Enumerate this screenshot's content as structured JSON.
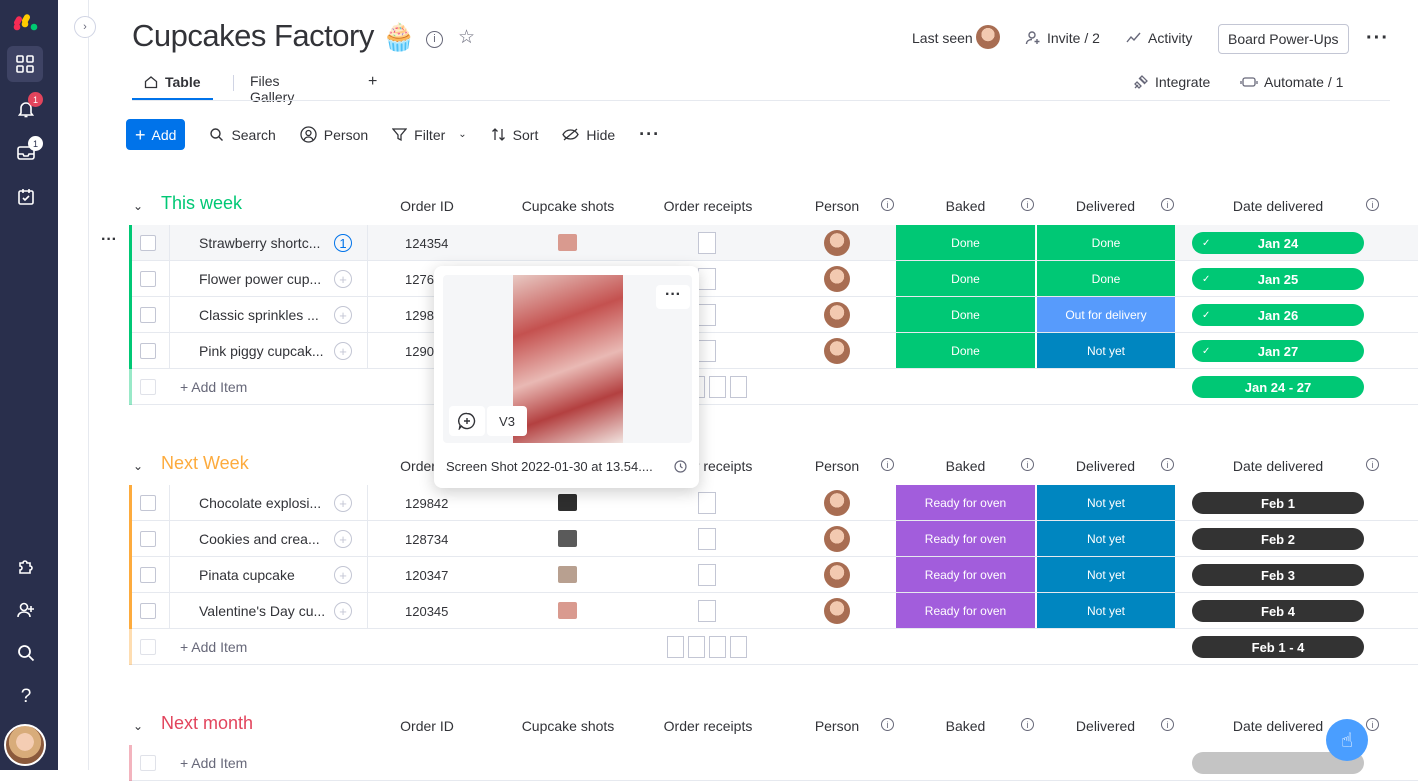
{
  "app": {
    "logo": "monday-logo"
  },
  "rail": {
    "notif_badge": "1",
    "inbox_badge": "1"
  },
  "board": {
    "title": "Cupcakes Factory",
    "emoji": "🧁"
  },
  "header": {
    "last_seen": "Last seen",
    "invite": "Invite / 2",
    "activity": "Activity",
    "powerups": "Board Power-Ups",
    "integrate": "Integrate",
    "automate": "Automate / 1"
  },
  "tabs": [
    {
      "label": "Table"
    },
    {
      "label": "Files Gallery"
    }
  ],
  "toolbar": {
    "add": "Add",
    "search": "Search",
    "person": "Person",
    "filter": "Filter",
    "sort": "Sort",
    "hide": "Hide"
  },
  "columns": {
    "order_id": "Order ID",
    "shots": "Cupcake shots",
    "receipts": "Order receipts",
    "person": "Person",
    "baked": "Baked",
    "delivered": "Delivered",
    "date": "Date delivered"
  },
  "colors": {
    "green": "#00c875",
    "orange": "#fdab3d",
    "red": "#e2445c",
    "purple": "#a25ddc",
    "blue": "#0086c0",
    "lightblue": "#579bfc",
    "dark": "#333333"
  },
  "groups": [
    {
      "title": "This week",
      "color": "#00c875",
      "items": [
        {
          "name": "Strawberry shortc...",
          "order_id": "124354",
          "baked": "Done",
          "delivered": "Done",
          "date": "Jan 24"
        },
        {
          "name": "Flower power cup...",
          "order_id": "1276",
          "baked": "Done",
          "delivered": "Done",
          "date": "Jan 25"
        },
        {
          "name": "Classic sprinkles ...",
          "order_id": "1298",
          "baked": "Done",
          "delivered": "Out for delivery",
          "date": "Jan 26"
        },
        {
          "name": "Pink piggy cupcak...",
          "order_id": "1290",
          "baked": "Done",
          "delivered": "Not yet",
          "date": "Jan 27"
        }
      ],
      "add_item": "+ Add Item",
      "summary_date": "Jan 24 - 27"
    },
    {
      "title": "Next Week",
      "color": "#fdab3d",
      "items": [
        {
          "name": "Chocolate explosi...",
          "order_id": "129842",
          "baked": "Ready for oven",
          "delivered": "Not yet",
          "date": "Feb 1"
        },
        {
          "name": "Cookies and crea...",
          "order_id": "128734",
          "baked": "Ready for oven",
          "delivered": "Not yet",
          "date": "Feb 2"
        },
        {
          "name": "Pinata cupcake",
          "order_id": "120347",
          "baked": "Ready for oven",
          "delivered": "Not yet",
          "date": "Feb 3"
        },
        {
          "name": "Valentine's Day cu...",
          "order_id": "120345",
          "baked": "Ready for oven",
          "delivered": "Not yet",
          "date": "Feb 4"
        }
      ],
      "add_item": "+ Add Item",
      "summary_date": "Feb 1 - 4"
    },
    {
      "title": "Next month",
      "color": "#e2445c",
      "items": [],
      "add_item": "+ Add Item"
    }
  ],
  "popup": {
    "version": "V3",
    "filename": "Screen Shot 2022-01-30 at 13.54...."
  }
}
